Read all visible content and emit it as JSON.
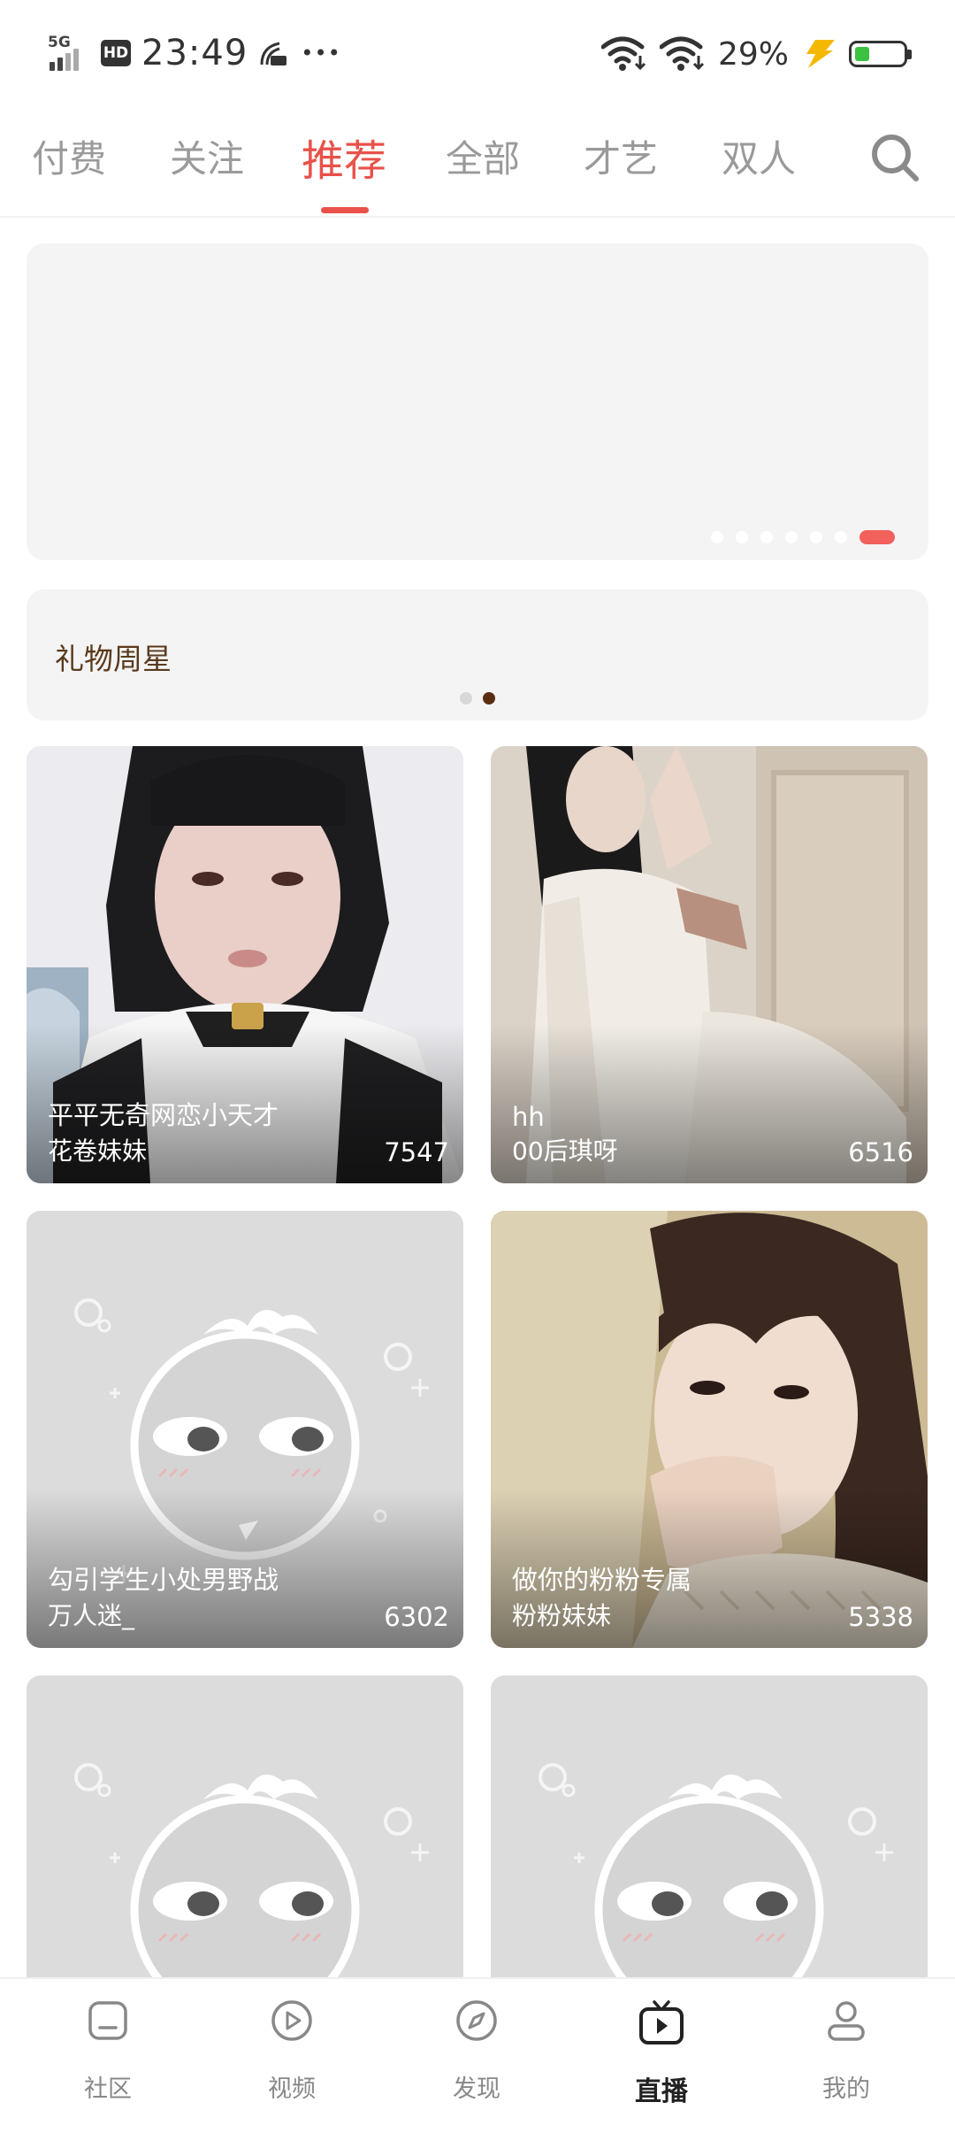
{
  "status_bar": {
    "network": "5G",
    "hd": "HD",
    "time": "23:49",
    "more": "•••",
    "battery_percent": "29%",
    "battery_level": 0.29
  },
  "tabs": [
    {
      "label": "付费"
    },
    {
      "label": "关注"
    },
    {
      "label": "推荐",
      "active": true
    },
    {
      "label": "全部"
    },
    {
      "label": "才艺"
    },
    {
      "label": "双人"
    }
  ],
  "banner": {
    "page_count": 7,
    "active_page": 7
  },
  "gift_card": {
    "label": "礼物周星",
    "page_count": 2,
    "active_page": 2
  },
  "streams": [
    {
      "title": "平平无奇网恋小天才",
      "name": "花卷妹妹",
      "viewers": "7547"
    },
    {
      "title": "hh",
      "name": "00后琪呀",
      "viewers": "6516"
    },
    {
      "title": "勾引学生小处男野战",
      "name": "万人迷_",
      "viewers": "6302"
    },
    {
      "title": "做你的粉粉专属",
      "name": "粉粉妹妹",
      "viewers": "5338"
    },
    {
      "title": "",
      "name": "",
      "viewers": ""
    },
    {
      "title": "",
      "name": "",
      "viewers": ""
    }
  ],
  "bottom_nav": [
    {
      "label": "社区",
      "icon": "community-icon"
    },
    {
      "label": "视频",
      "icon": "video-icon"
    },
    {
      "label": "发现",
      "icon": "discover-icon"
    },
    {
      "label": "直播",
      "icon": "live-tv-icon",
      "active": true
    },
    {
      "label": "我的",
      "icon": "profile-icon"
    }
  ],
  "colors": {
    "accent": "#e8524a",
    "gift_text": "#5a3a1c",
    "placeholder_bg": "#dcdcdc"
  }
}
